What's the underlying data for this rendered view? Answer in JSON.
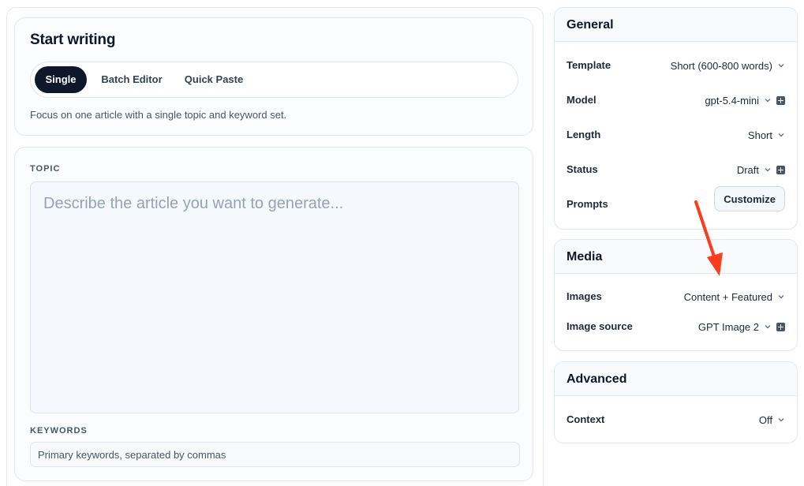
{
  "start": {
    "title": "Start writing",
    "tabs": [
      "Single",
      "Batch Editor",
      "Quick Paste"
    ],
    "description": "Focus on one article with a single topic and keyword set."
  },
  "form": {
    "topic_label": "TOPIC",
    "topic_placeholder": "Describe the article you want to generate...",
    "keywords_label": "KEYWORDS",
    "keywords_placeholder": "Primary keywords, separated by commas"
  },
  "general": {
    "title": "General",
    "template_label": "Template",
    "template_value": "Short (600-800 words)",
    "model_label": "Model",
    "model_value": "gpt-5.4-mini",
    "length_label": "Length",
    "length_value": "Short",
    "status_label": "Status",
    "status_value": "Draft",
    "prompts_label": "Prompts",
    "customize_label": "Customize"
  },
  "media": {
    "title": "Media",
    "images_label": "Images",
    "images_value": "Content + Featured",
    "source_label": "Image source",
    "source_value": "GPT Image 2"
  },
  "advanced": {
    "title": "Advanced",
    "context_label": "Context",
    "context_value": "Off"
  },
  "colors": {
    "accent_dark": "#0f172a",
    "annotation_arrow": "#ff3b1f"
  },
  "icons": {
    "chevron": "chevron-down-icon",
    "toggle": "plus-square-icon"
  }
}
